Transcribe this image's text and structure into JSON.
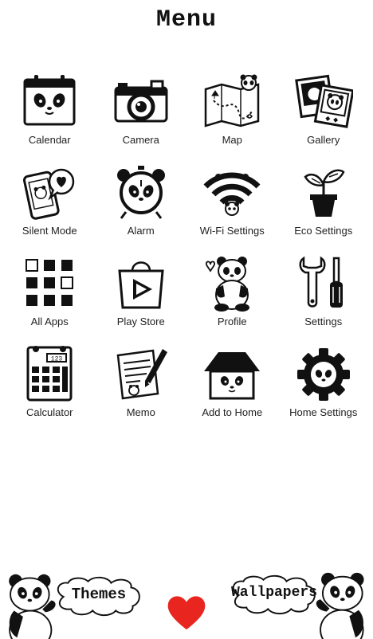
{
  "title": "Menu",
  "apps": [
    {
      "label": "Calendar",
      "icon": "calendar-icon"
    },
    {
      "label": "Camera",
      "icon": "camera-icon"
    },
    {
      "label": "Map",
      "icon": "map-icon"
    },
    {
      "label": "Gallery",
      "icon": "gallery-icon"
    },
    {
      "label": "Silent Mode",
      "icon": "silent-mode-icon"
    },
    {
      "label": "Alarm",
      "icon": "alarm-icon"
    },
    {
      "label": "Wi-Fi Settings",
      "icon": "wifi-icon"
    },
    {
      "label": "Eco Settings",
      "icon": "plant-icon"
    },
    {
      "label": "All Apps",
      "icon": "all-apps-icon"
    },
    {
      "label": "Play Store",
      "icon": "play-store-icon"
    },
    {
      "label": "Profile",
      "icon": "panda-profile-icon"
    },
    {
      "label": "Settings",
      "icon": "wrench-screwdriver-icon"
    },
    {
      "label": "Calculator",
      "icon": "calculator-icon"
    },
    {
      "label": "Memo",
      "icon": "memo-icon"
    },
    {
      "label": "Add to Home",
      "icon": "house-icon"
    },
    {
      "label": "Home Settings",
      "icon": "gear-icon"
    }
  ],
  "calculator_display": "123",
  "bottom": {
    "themes_label": "Themes",
    "wallpapers_label": "Wallpapers"
  },
  "colors": {
    "background": "#ffffff",
    "ink": "#111111",
    "heart": "#e8261f"
  }
}
